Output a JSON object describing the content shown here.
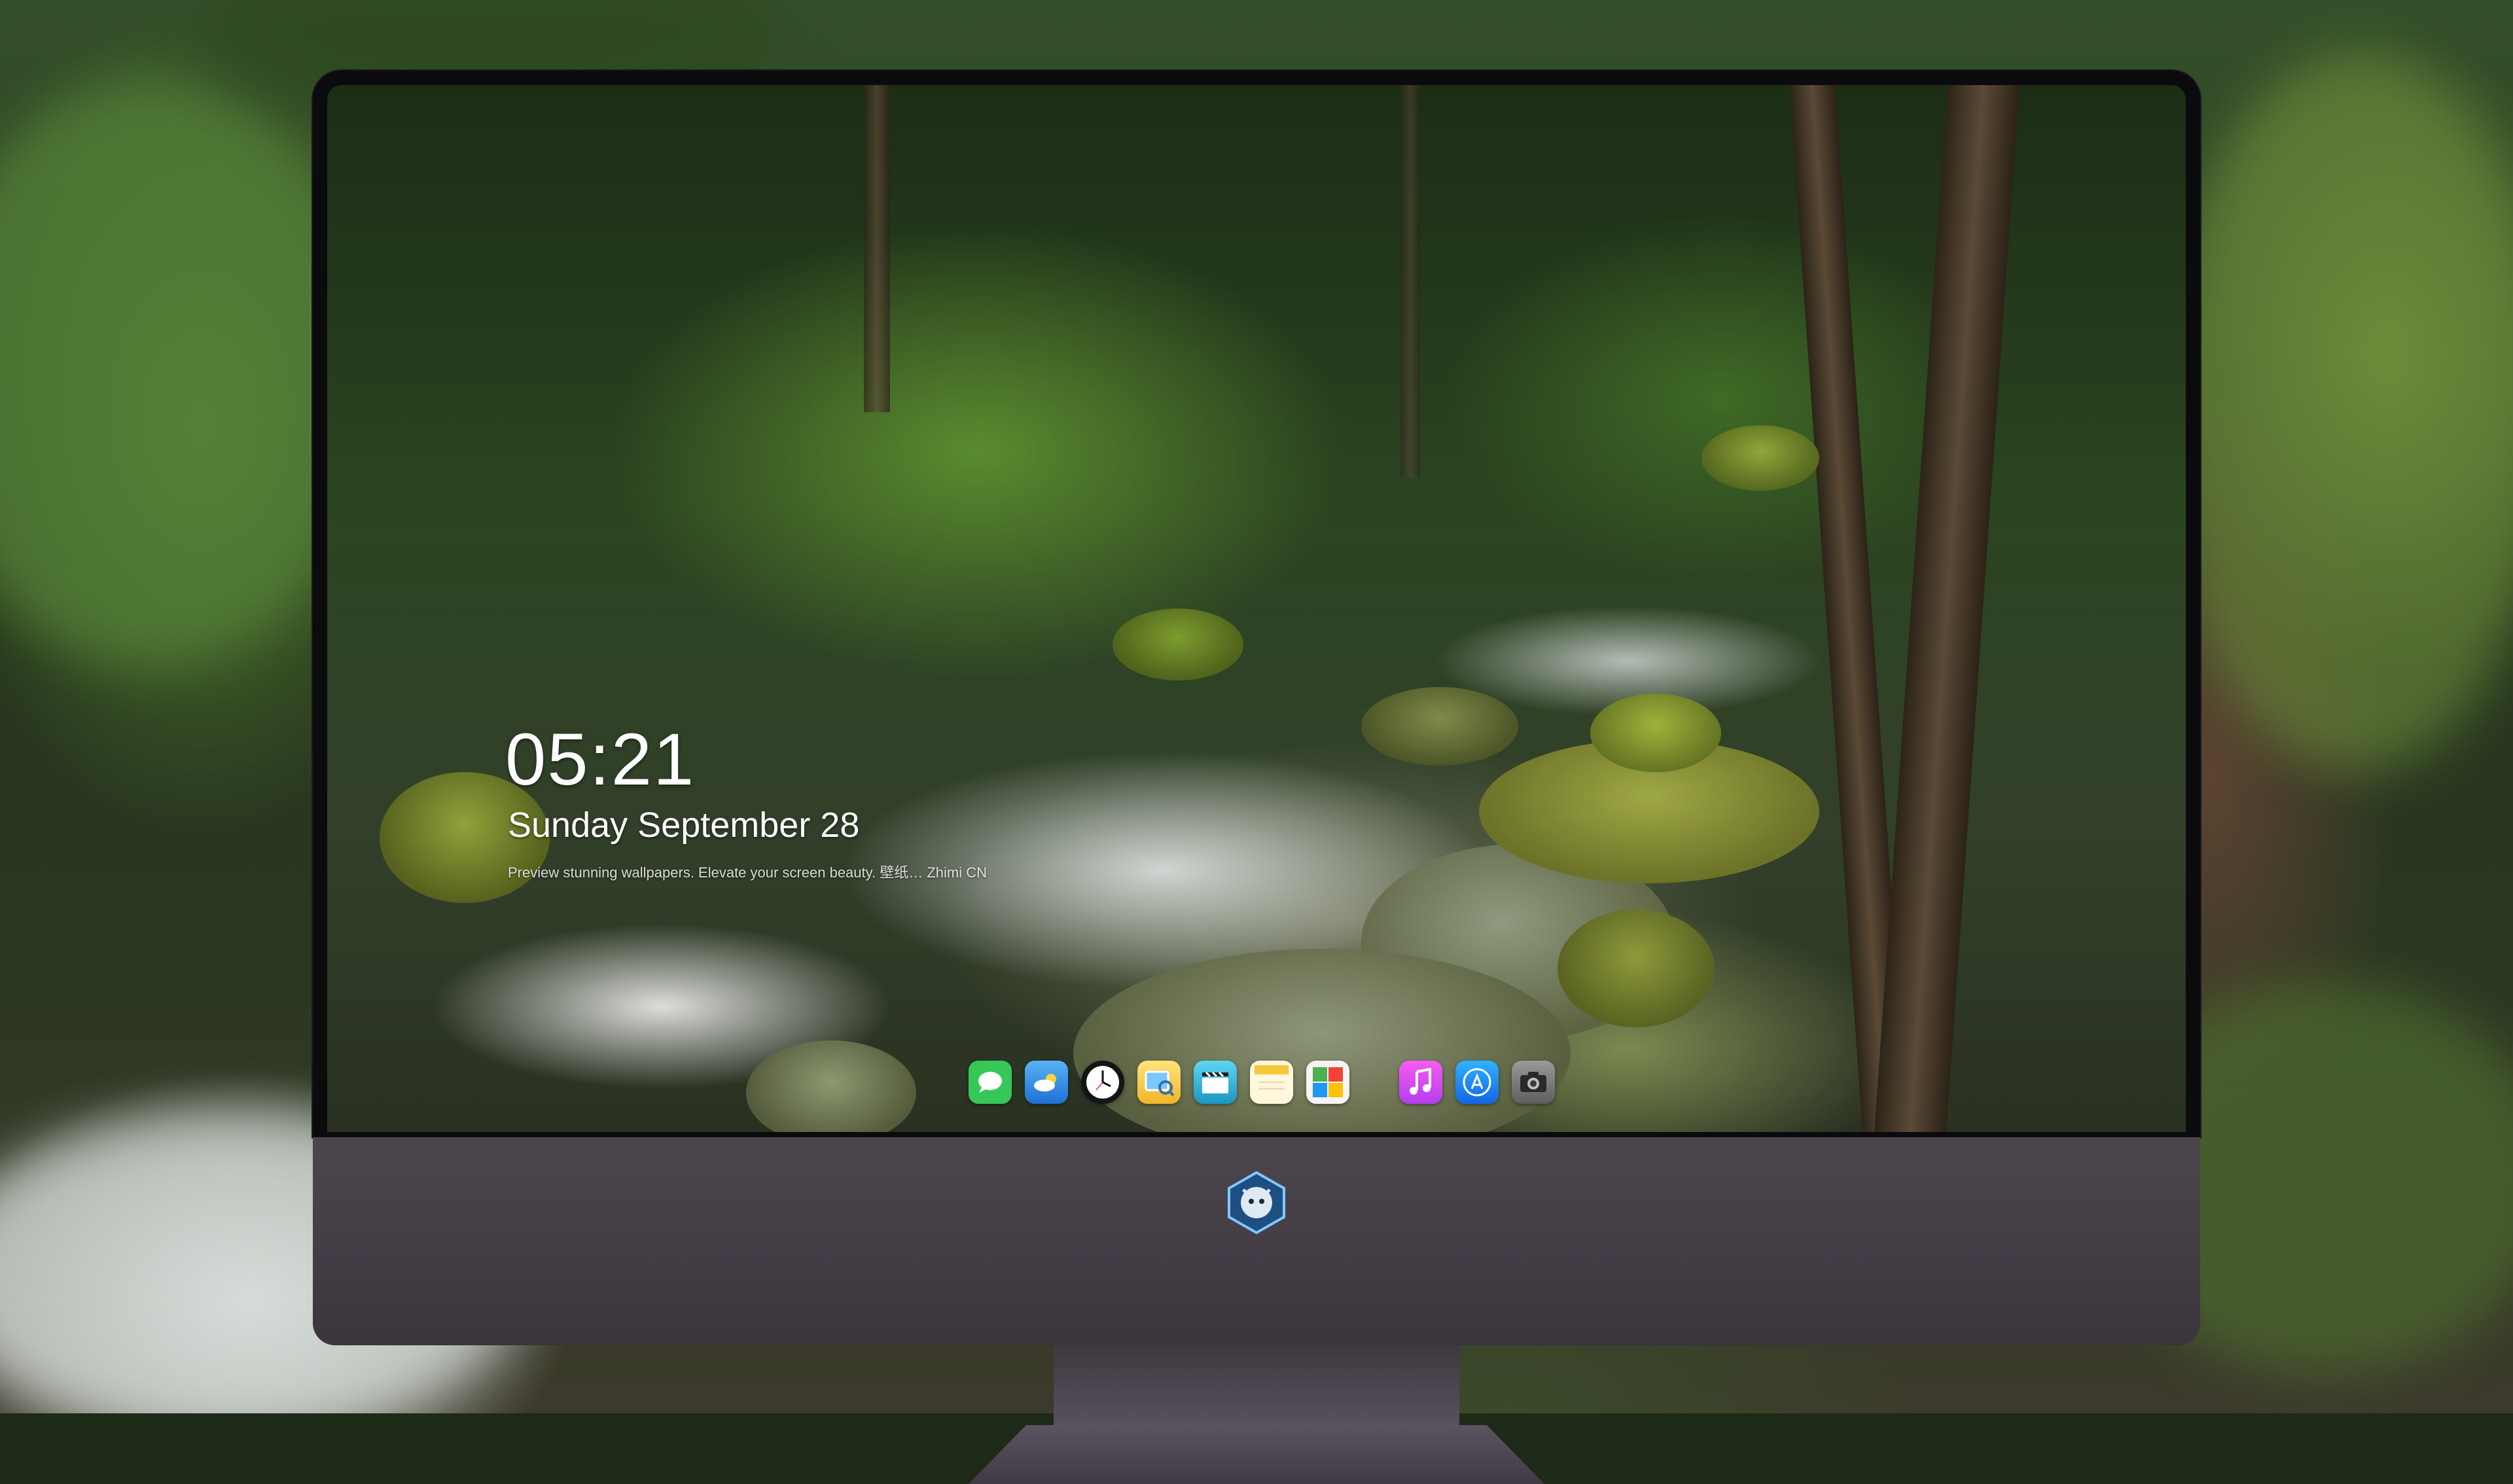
{
  "lock_screen": {
    "time": "05:21",
    "date": "Sunday September  28",
    "caption": "Preview stunning wallpapers. Elevate your screen beauty. 壁纸… Zhimi CN"
  },
  "dock": {
    "items": [
      {
        "name": "messages",
        "icon": "messages-icon",
        "color": "#37c759"
      },
      {
        "name": "weather",
        "icon": "weather-icon",
        "color": "#2f86e8"
      },
      {
        "name": "clock",
        "icon": "clock-icon",
        "color": "#1a1a1a"
      },
      {
        "name": "preview",
        "icon": "preview-icon",
        "color": "#f2c94c"
      },
      {
        "name": "clips",
        "icon": "clips-icon",
        "color": "#2fb5d6"
      },
      {
        "name": "notes",
        "icon": "notes-icon",
        "color": "#f5d34a"
      },
      {
        "name": "photo-booth",
        "icon": "photo-booth-icon",
        "color": "#e8e8e8"
      },
      {
        "name": "itunes",
        "icon": "itunes-icon",
        "color": "#e24ddb"
      },
      {
        "name": "app-store",
        "icon": "app-store-icon",
        "color": "#1e8ff2"
      },
      {
        "name": "camera",
        "icon": "camera-icon",
        "color": "#7d7d7d"
      }
    ]
  },
  "monitor": {
    "logo": "monitor-logo-badge"
  }
}
